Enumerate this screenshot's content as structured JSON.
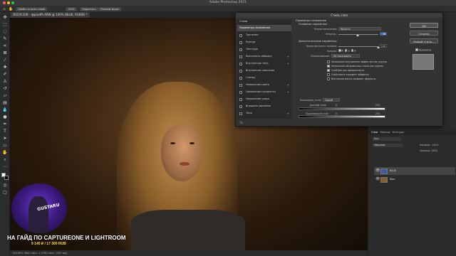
{
  "app": {
    "title": "Adobe Photoshop 2021"
  },
  "options_bar": {
    "sample_select": "Пробы со всех слоев",
    "zoom_button": "100%",
    "fit_button": "Подогнать",
    "fill_button": "Полный экран"
  },
  "document_tab": "DSC0C108 – @prodfh.ARW @ 140% (BLUE, RGB/8) *",
  "status_bar": "140,69%    3840 пикс. x 5760 пикс. (300 ppi)",
  "watermark": {
    "text": "НА ГАЙД ПО CAPTUREONE И LIGHTROOM",
    "price": "9 140 ₽ / 17 300 RUB",
    "webcam_text": "GUSTARU"
  },
  "layers_panel": {
    "tabs": [
      "Слои",
      "Каналы",
      "Контуры"
    ],
    "search_placeholder": "Вид",
    "blend_mode": "Обычные",
    "opacity": "Непрозр.: 100%",
    "fill": "Заливка: 100%",
    "layers": [
      {
        "name": "BLUE",
        "thumb_color": "#3b5ba8"
      },
      {
        "name": "Фон",
        "thumb_color": "#8a5e2a"
      }
    ]
  },
  "dialog": {
    "title": "Стиль слоя",
    "list_header": "Стили",
    "list": [
      {
        "label": "Параметры наложения",
        "active": true,
        "checkbox": false,
        "plus": false
      },
      {
        "label": "Тиснение",
        "active": false,
        "checkbox": true,
        "plus": false
      },
      {
        "label": "Контур",
        "active": false,
        "checkbox": true,
        "plus": false
      },
      {
        "label": "Текстура",
        "active": false,
        "checkbox": true,
        "plus": false
      },
      {
        "label": "Выполнить обводку",
        "active": false,
        "checkbox": true,
        "plus": true
      },
      {
        "label": "Внутренняя тень",
        "active": false,
        "checkbox": true,
        "plus": true
      },
      {
        "label": "Внутреннее свечение",
        "active": false,
        "checkbox": true,
        "plus": false
      },
      {
        "label": "Глянец",
        "active": false,
        "checkbox": true,
        "plus": false
      },
      {
        "label": "Наложение цвета",
        "active": false,
        "checkbox": true,
        "plus": true
      },
      {
        "label": "Наложение градиента",
        "active": false,
        "checkbox": true,
        "plus": true
      },
      {
        "label": "Наложение узора",
        "active": false,
        "checkbox": true,
        "plus": false
      },
      {
        "label": "Внешнее свечение",
        "active": false,
        "checkbox": true,
        "plus": false
      },
      {
        "label": "Тень",
        "active": false,
        "checkbox": true,
        "plus": true
      }
    ],
    "footer_icon": "fx",
    "blending": {
      "section_title": "Параметры наложения",
      "general_title": "Основные параметры",
      "blend_mode_label": "Режим наложения:",
      "blend_mode_value": "Яркость",
      "opacity_label": "Непрозр.:",
      "opacity_value": "48",
      "opacity_fraction": 0.48,
      "advanced_title": "Дополнительные параметры",
      "fill_label": "Непрозрачность заливки:",
      "fill_value": "100",
      "fill_fraction": 1.0,
      "channels_label": "Каналы:",
      "channels": [
        "R",
        "G",
        "B"
      ],
      "knockout_label": "Просвечивание:",
      "knockout_value": "Не показывать",
      "checkboxes": [
        {
          "label": "Наложение внутренних эффектов как группы",
          "on": false
        },
        {
          "label": "Наложение обтравочных слоев как группы",
          "on": true
        },
        {
          "label": "Слой-фигура прозрачности",
          "on": true
        },
        {
          "label": "Слой-маска скрывает эффекты",
          "on": false
        },
        {
          "label": "Векторная маска скрывает эффекты",
          "on": false
        }
      ],
      "blend_if_label": "Наложение, если:",
      "blend_if_value": "Серый",
      "this_layer_label": "Данный слой:",
      "this_layer_min": "0",
      "this_layer_max": "255",
      "underlying_label": "Подлежащий слой:",
      "underlying_min": "0",
      "underlying_max": "255"
    },
    "buttons": {
      "ok": "OK",
      "cancel": "Отмена",
      "new_style": "Новый стиль...",
      "preview": "Просмотр"
    }
  },
  "colors": {
    "accent_selection": "#3d6fd0",
    "dialog_bg": "#323232",
    "watermark_price": "#ffd84a"
  }
}
